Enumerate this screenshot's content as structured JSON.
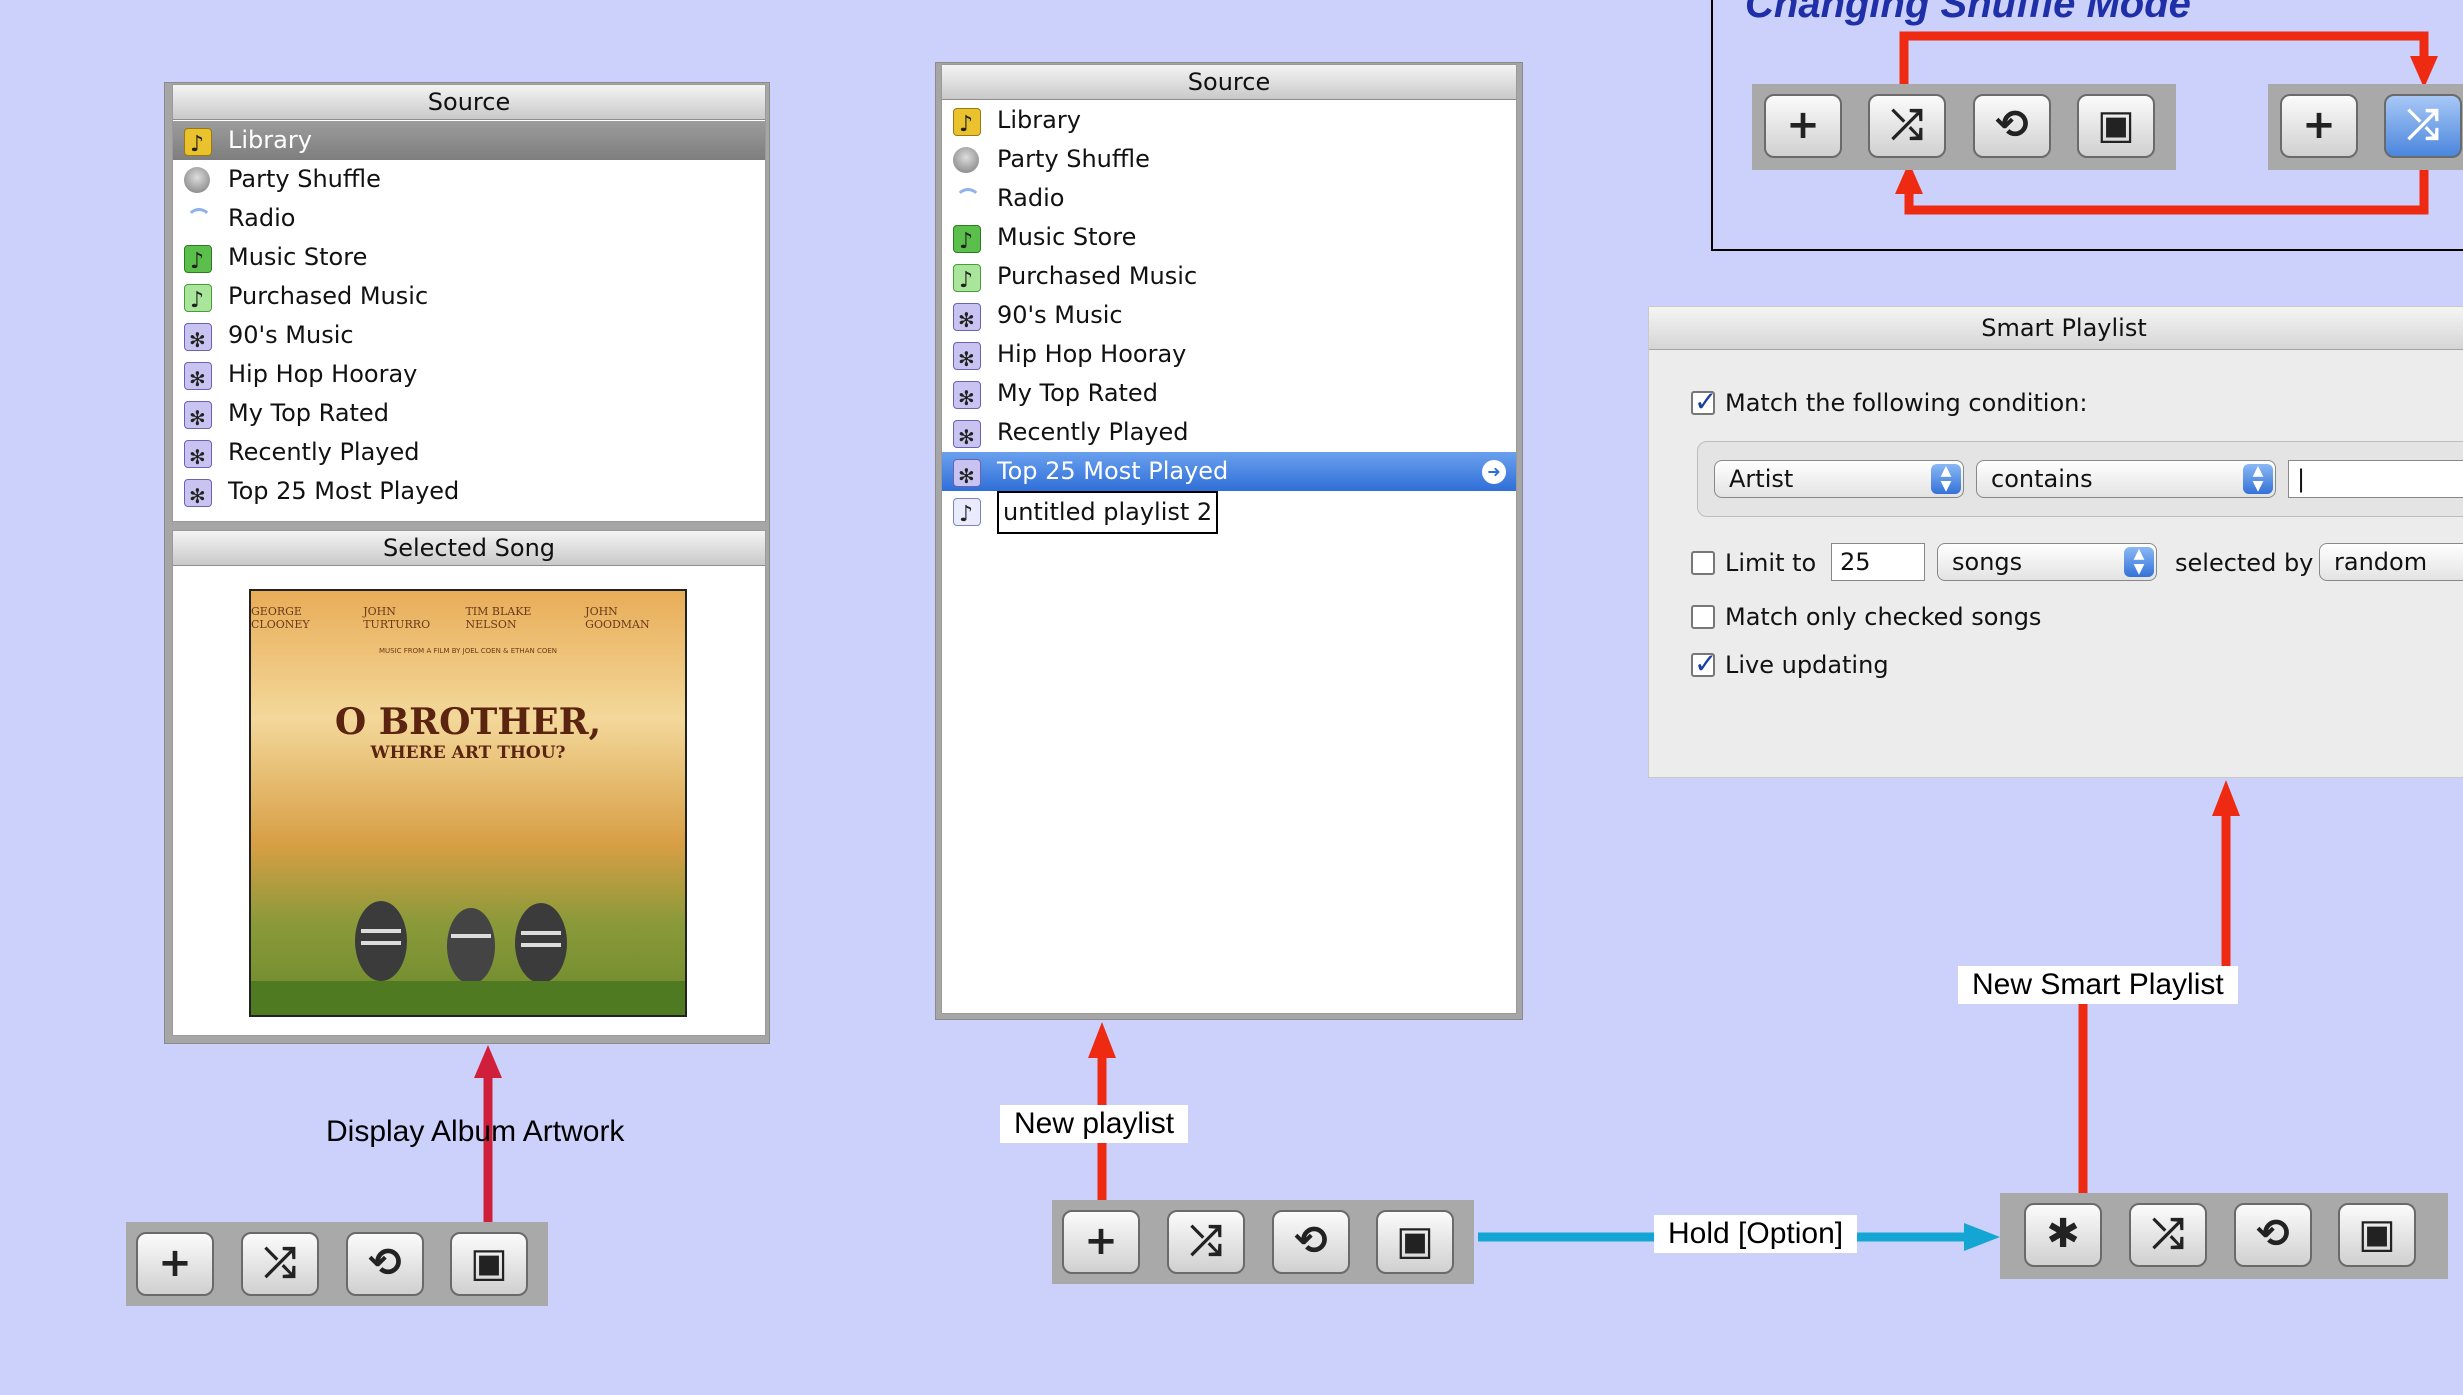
{
  "source_header": "Source",
  "selected_song_header": "Selected Song",
  "left_sources": [
    {
      "label": "Library",
      "icon": "library-icon"
    },
    {
      "label": "Party Shuffle",
      "icon": "party-shuffle-icon"
    },
    {
      "label": "Radio",
      "icon": "radio-icon"
    },
    {
      "label": "Music Store",
      "icon": "music-store-icon"
    },
    {
      "label": "Purchased Music",
      "icon": "purchased-music-icon"
    },
    {
      "label": "90's Music",
      "icon": "smart-playlist-icon"
    },
    {
      "label": "Hip Hop Hooray",
      "icon": "smart-playlist-icon"
    },
    {
      "label": "My Top Rated",
      "icon": "smart-playlist-icon"
    },
    {
      "label": "Recently Played",
      "icon": "smart-playlist-icon"
    },
    {
      "label": "Top 25 Most Played",
      "icon": "smart-playlist-icon"
    }
  ],
  "mid_sources": [
    {
      "label": "Library",
      "icon": "library-icon"
    },
    {
      "label": "Party Shuffle",
      "icon": "party-shuffle-icon"
    },
    {
      "label": "Radio",
      "icon": "radio-icon"
    },
    {
      "label": "Music Store",
      "icon": "music-store-icon"
    },
    {
      "label": "Purchased Music",
      "icon": "purchased-music-icon"
    },
    {
      "label": "90's Music",
      "icon": "smart-playlist-icon"
    },
    {
      "label": "Hip Hop Hooray",
      "icon": "smart-playlist-icon"
    },
    {
      "label": "My Top Rated",
      "icon": "smart-playlist-icon"
    },
    {
      "label": "Recently Played",
      "icon": "smart-playlist-icon"
    },
    {
      "label": "Top 25 Most Played",
      "icon": "smart-playlist-icon"
    },
    {
      "label": "untitled playlist 2",
      "icon": "playlist-icon"
    }
  ],
  "album": {
    "actors": [
      "GEORGE CLOONEY",
      "JOHN TURTURRO",
      "TIM BLAKE NELSON",
      "JOHN GOODMAN"
    ],
    "credit": "MUSIC FROM A FILM BY JOEL COEN & ETHAN COEN",
    "title": "O BROTHER,",
    "subtitle": "WHERE ART THOU?"
  },
  "labels": {
    "display_artwork": "Display Album Artwork",
    "new_playlist": "New playlist",
    "hold_option": "Hold [Option]",
    "new_smart_playlist": "New Smart Playlist",
    "shuffle_title": "Changing Shuffle Mode"
  },
  "toolbar": {
    "add": "+",
    "shuffle": "⤮",
    "repeat": "⟲",
    "artwork": "▣",
    "gear": "✱"
  },
  "smart_playlist": {
    "title": "Smart Playlist",
    "match_label": "Match the following condition:",
    "field": "Artist",
    "operator": "contains",
    "limit_label": "Limit to",
    "limit_value": "25",
    "limit_unit": "songs",
    "selected_by_label": "selected by",
    "selected_by_value": "random",
    "match_checked_label": "Match only checked songs",
    "live_updating_label": "Live updating"
  },
  "colors": {
    "background": "#ccd1fb",
    "arrow_red": "#ee2a12",
    "arrow_blue": "#14a6d2",
    "arrow_crimson": "#d01f3a",
    "title_blue": "#1f2fa8"
  }
}
